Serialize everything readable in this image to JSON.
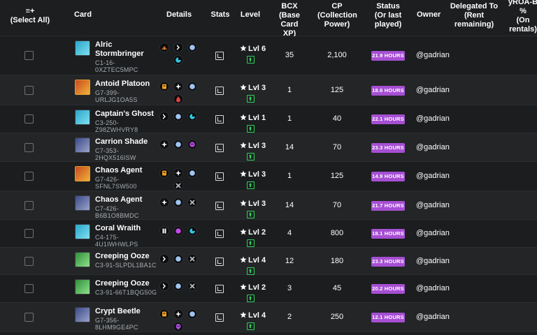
{
  "headers": {
    "select_all_icon": "≡+",
    "select_all": "(Select All)",
    "card": "Card",
    "details": "Details",
    "stats": "Stats",
    "level": "Level",
    "bcx": [
      "BCX",
      "(Base Card",
      "XP)"
    ],
    "cp": [
      "CP",
      "(Collection",
      "Power)"
    ],
    "status": [
      "Status",
      "(Or last",
      "played)"
    ],
    "owner": "Owner",
    "delegated": [
      "Delegated To",
      "(Rent",
      "remaining)"
    ],
    "yroab": [
      "yROA-B",
      "%",
      "(On",
      "rentals)"
    ]
  },
  "colors": {
    "status_badge": "#a64fd3",
    "upgrade": "#2fcf5a",
    "row_odd": "#1b1d1f",
    "row_even": "#232527"
  },
  "rows": [
    {
      "name": "Alric Stormbringer",
      "name_lines": [
        "Alric",
        "Stormbringer"
      ],
      "id_lines": [
        "C1-16-",
        "0XZTEC5MPC"
      ],
      "element": "water",
      "abilities": [
        "fire-blast-icon",
        "sneak-icon",
        "shield-icon",
        "swim-icon"
      ],
      "level": "Lvl 6",
      "bcx": "35",
      "cp": "2,100",
      "status": "21.9 HOURS",
      "owner": "@gadrian"
    },
    {
      "name": "Antoid Platoon",
      "name_lines": [
        "Antoid Platoon"
      ],
      "id_lines": [
        "G7-399-",
        "URLJG1OA5S"
      ],
      "element": "fire",
      "abilities": [
        "armor-icon",
        "dodge-icon",
        "shield-icon",
        "bloodlust-icon"
      ],
      "level": "Lvl 3",
      "bcx": "1",
      "cp": "125",
      "status": "18.6 HOURS",
      "owner": "@gadrian"
    },
    {
      "name": "Captain's Ghost",
      "name_lines": [
        "Captain's Ghost"
      ],
      "id_lines": [
        "C3-250-",
        "Z98ZWHVRY8"
      ],
      "element": "water",
      "abilities": [
        "sneak-icon",
        "shield-icon",
        "swim-icon"
      ],
      "level": "Lvl 1",
      "bcx": "1",
      "cp": "40",
      "status": "22.1 HOURS",
      "owner": "@gadrian"
    },
    {
      "name": "Carrion Shade",
      "name_lines": [
        "Carrion Shade"
      ],
      "id_lines": [
        "C7-353-",
        "2HQX516ISW"
      ],
      "element": "death",
      "abilities": [
        "dodge-icon",
        "shield-icon",
        "spirit-icon"
      ],
      "level": "Lvl 3",
      "bcx": "14",
      "cp": "70",
      "status": "23.3 HOURS",
      "owner": "@gadrian"
    },
    {
      "name": "Chaos Agent",
      "name_lines": [
        "Chaos Agent"
      ],
      "id_lines": [
        "G7-426-",
        "SFNL7SW500"
      ],
      "element": "fire",
      "abilities": [
        "armor-icon",
        "dodge-icon",
        "shield-icon",
        "cross-icon"
      ],
      "level": "Lvl 3",
      "bcx": "1",
      "cp": "125",
      "status": "14.9 HOURS",
      "owner": "@gadrian"
    },
    {
      "name": "Chaos Agent",
      "name_lines": [
        "Chaos Agent"
      ],
      "id_lines": [
        "C7-426-",
        "B6B1O8BMDC"
      ],
      "element": "death",
      "abilities": [
        "dodge-icon",
        "shield-icon",
        "cross-icon"
      ],
      "level": "Lvl 3",
      "bcx": "14",
      "cp": "70",
      "status": "21.7 HOURS",
      "owner": "@gadrian"
    },
    {
      "name": "Coral Wraith",
      "name_lines": [
        "Coral Wraith"
      ],
      "id_lines": [
        "C4-175-",
        "4U1IWHWLPS"
      ],
      "element": "water",
      "abilities": [
        "pause-icon",
        "magic-icon",
        "swim-icon"
      ],
      "level": "Lvl 2",
      "bcx": "4",
      "cp": "800",
      "status": "18.1 HOURS",
      "owner": "@gadrian"
    },
    {
      "name": "Creeping Ooze",
      "name_lines": [
        "Creeping Ooze"
      ],
      "id_lines": [
        "C3-91-SLPDL1BA1C"
      ],
      "element": "earth",
      "abilities": [
        "sneak-icon",
        "shield-icon",
        "cross-icon"
      ],
      "level": "Lvl 4",
      "bcx": "12",
      "cp": "180",
      "status": "23.3 HOURS",
      "owner": "@gadrian"
    },
    {
      "name": "Creeping Ooze",
      "name_lines": [
        "Creeping Ooze"
      ],
      "id_lines": [
        "C3-91-66T1BQG50G"
      ],
      "element": "earth",
      "abilities": [
        "sneak-icon",
        "shield-icon",
        "cross-icon"
      ],
      "level": "Lvl 2",
      "bcx": "3",
      "cp": "45",
      "status": "20.2 HOURS",
      "owner": "@gadrian"
    },
    {
      "name": "Crypt Beetle",
      "name_lines": [
        "Crypt Beetle"
      ],
      "id_lines": [
        "G7-356-",
        "8LHM9GE4PC"
      ],
      "element": "death",
      "abilities": [
        "armor-icon",
        "dodge-icon",
        "shield-icon",
        "skull-icon"
      ],
      "level": "Lvl 4",
      "bcx": "2",
      "cp": "250",
      "status": "12.1 HOURS",
      "owner": "@gadrian"
    }
  ]
}
